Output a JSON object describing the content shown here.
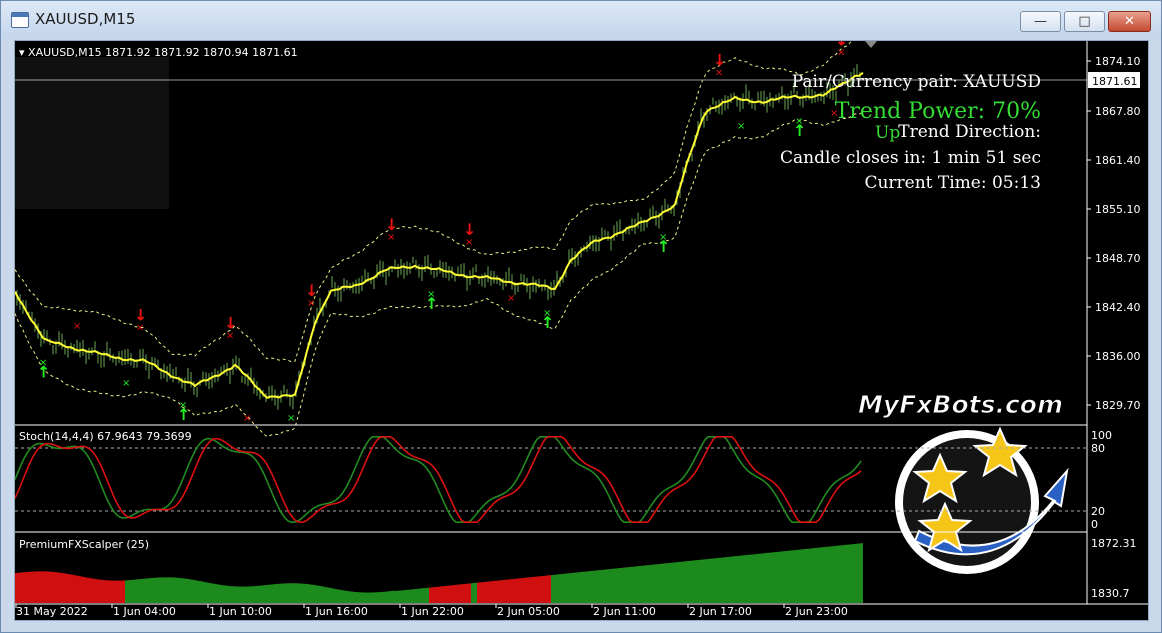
{
  "window": {
    "title": "XAUUSD,M15",
    "min_glyph": "—",
    "max_glyph": "□",
    "close_glyph": "✕"
  },
  "main_chart": {
    "header": "XAUUSD,M15  1871.92 1871.92 1870.94 1871.61",
    "current_price": "1871.61",
    "price_ticks": [
      "1874.10",
      "1867.80",
      "1861.40",
      "1855.10",
      "1848.70",
      "1842.40",
      "1836.00",
      "1829.70"
    ],
    "info": {
      "pair": "Pair/Currency pair: XAUUSD",
      "trend_power": "Trend Power: 70%",
      "trend_direction": "Trend Direction:",
      "trend_value": "Up",
      "candle_closes": "Candle closes in: 1 min 51 sec",
      "current_time": "Current Time: 05:13"
    },
    "watermark": "MyFxBots.com"
  },
  "stoch_panel": {
    "label": "Stoch(14,4,4) 67.9643 79.3699",
    "ticks": [
      "100",
      "80",
      "20",
      "0"
    ]
  },
  "scalper_panel": {
    "label": "PremiumFXScalper (25)",
    "ticks": [
      "1872.31",
      "1830.7"
    ]
  },
  "time_axis": [
    "31 May 2022",
    "1 Jun 04:00",
    "1 Jun 10:00",
    "1 Jun 16:00",
    "1 Jun 22:00",
    "2 Jun 05:00",
    "2 Jun 11:00",
    "2 Jun 17:00",
    "2 Jun 23:00"
  ],
  "colors": {
    "background": "#000000",
    "ma_line": "#ffff33",
    "candles": "#6aa84f",
    "stoch_main": "#228b22",
    "stoch_signal": "#dd1111",
    "buy_arrow": "#22ee22",
    "sell_arrow": "#ee1111",
    "scalper_bull": "#1d8a1d",
    "scalper_bear": "#d01010",
    "trend_power_color": "#33dd33"
  }
}
